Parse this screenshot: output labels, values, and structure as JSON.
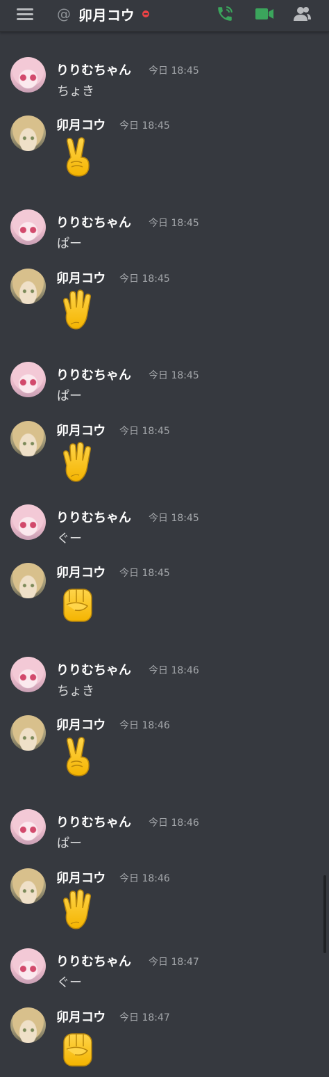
{
  "header": {
    "at_symbol": "@",
    "title": "卯月コウ",
    "status": "dnd",
    "icons": [
      "menu-icon",
      "at-icon",
      "call-icon",
      "video-icon",
      "members-icon"
    ],
    "accent_color": "#3ba55c"
  },
  "messages": [
    {
      "author": "りりむちゃん",
      "time": "今日 18:45",
      "text": "ちょき"
    },
    {
      "author": "卯月コウ",
      "time": "今日 18:45",
      "emoji": "victory-hand"
    },
    {
      "author": "りりむちゃん",
      "time": "今日 18:45",
      "text": "ぱー"
    },
    {
      "author": "卯月コウ",
      "time": "今日 18:45",
      "emoji": "raised-hand"
    },
    {
      "author": "りりむちゃん",
      "time": "今日 18:45",
      "text": "ぱー"
    },
    {
      "author": "卯月コウ",
      "time": "今日 18:45",
      "emoji": "raised-hand"
    },
    {
      "author": "りりむちゃん",
      "time": "今日 18:45",
      "text": "ぐー"
    },
    {
      "author": "卯月コウ",
      "time": "今日 18:45",
      "emoji": "raised-fist"
    },
    {
      "author": "りりむちゃん",
      "time": "今日 18:46",
      "text": "ちょき"
    },
    {
      "author": "卯月コウ",
      "time": "今日 18:46",
      "emoji": "victory-hand"
    },
    {
      "author": "りりむちゃん",
      "time": "今日 18:46",
      "text": "ぱー"
    },
    {
      "author": "卯月コウ",
      "time": "今日 18:46",
      "emoji": "raised-hand"
    },
    {
      "author": "りりむちゃん",
      "time": "今日 18:47",
      "text": "ぐー"
    },
    {
      "author": "卯月コウ",
      "time": "今日 18:47",
      "emoji": "raised-fist"
    }
  ]
}
